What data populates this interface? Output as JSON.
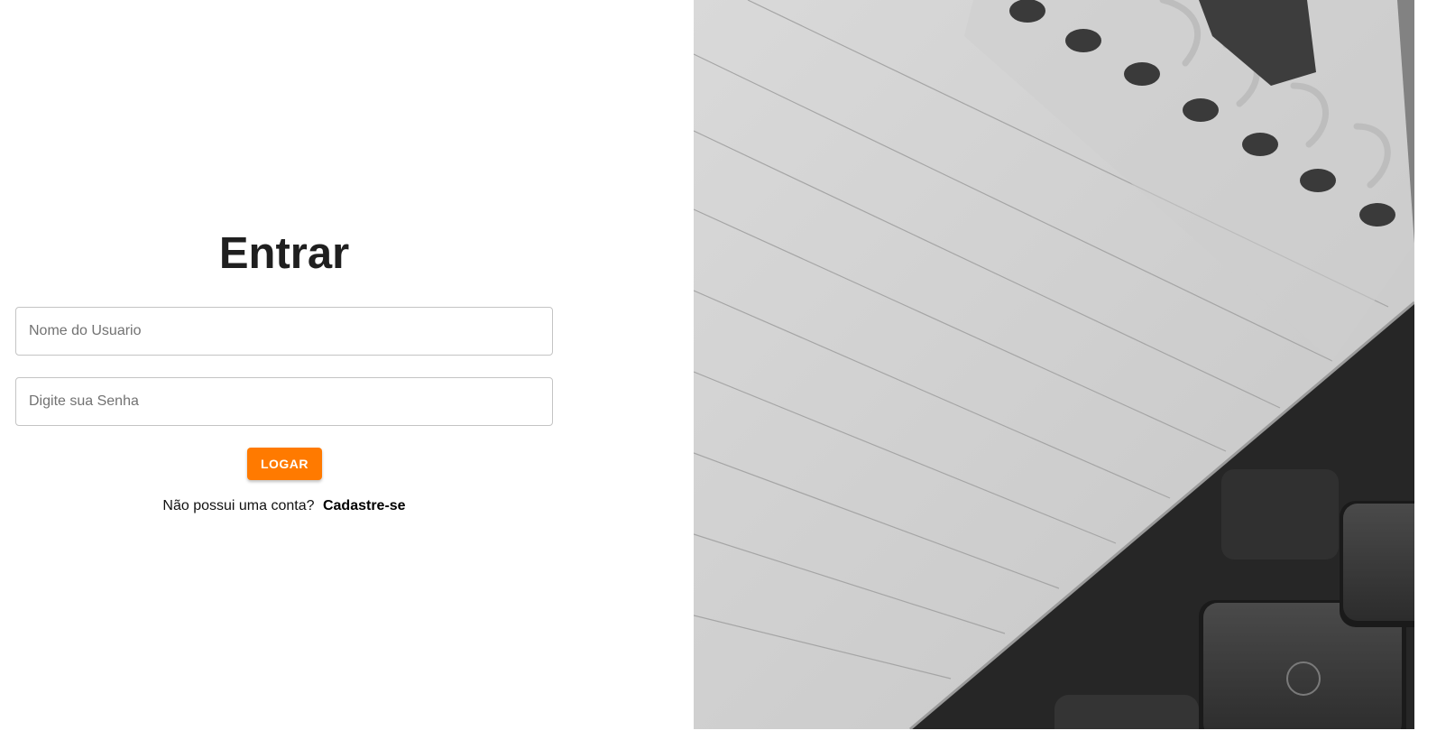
{
  "login": {
    "title": "Entrar",
    "username_placeholder": "Nome do Usuario",
    "password_placeholder": "Digite sua Senha",
    "submit_label": "LOGAR",
    "signup_prompt": "Não possui uma conta?",
    "signup_link": "Cadastre-se"
  },
  "colors": {
    "accent": "#ff7a00",
    "title": "#1f1f1f",
    "field_border": "#c4c4c4"
  },
  "image": {
    "semantic": "notebook-keyboard-photo"
  }
}
